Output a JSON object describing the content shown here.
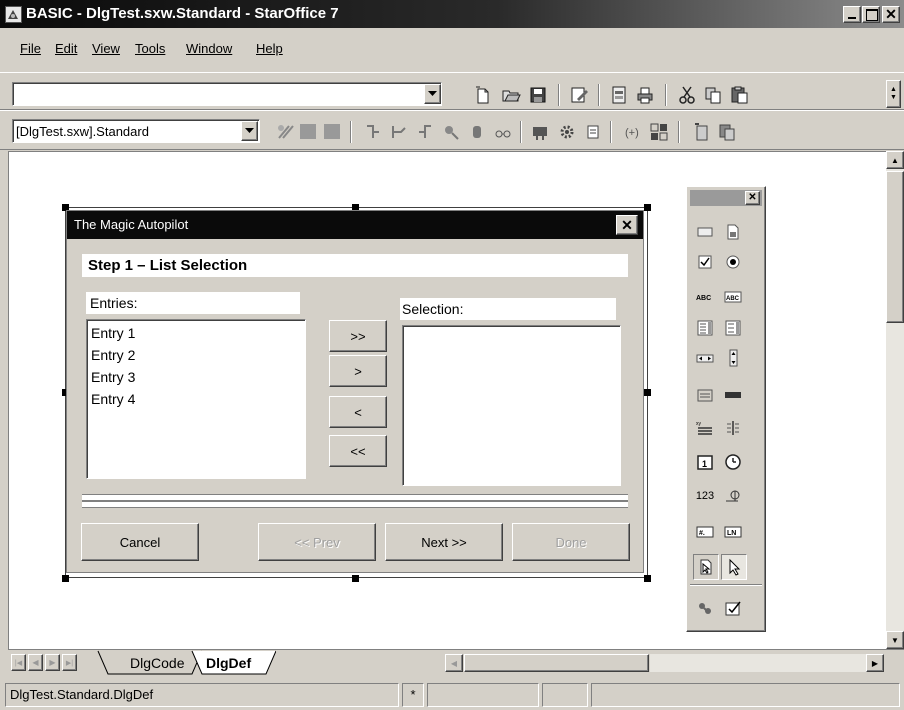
{
  "window": {
    "title": "BASIC - DlgTest.sxw.Standard - StarOffice 7"
  },
  "menu": [
    {
      "label": "File"
    },
    {
      "label": "Edit"
    },
    {
      "label": "View"
    },
    {
      "label": "Tools"
    },
    {
      "label": "Window"
    },
    {
      "label": "Help"
    }
  ],
  "toolbar": {
    "url_value": ""
  },
  "macro_toolbar": {
    "library_value": "[DlgTest.sxw].Standard"
  },
  "dialog": {
    "title": "The Magic Autopilot",
    "step_label": "Step 1 – List Selection",
    "entries_label": "Entries:",
    "selection_label": "Selection:",
    "entries": [
      "Entry 1",
      "Entry 2",
      "Entry 3",
      "Entry 4"
    ],
    "btn_add_all": ">>",
    "btn_add": ">",
    "btn_remove": "<",
    "btn_remove_all": "<<",
    "btn_cancel": "Cancel",
    "btn_prev": "<< Prev",
    "btn_next": "Next >>",
    "btn_done": "Done"
  },
  "controls_toolbox": {
    "abc": "ABC",
    "num": "123"
  },
  "tabs": [
    {
      "label": "DlgCode"
    },
    {
      "label": "DlgDef"
    }
  ],
  "status": {
    "location": "DlgTest.Standard.DlgDef",
    "modified": "*"
  }
}
